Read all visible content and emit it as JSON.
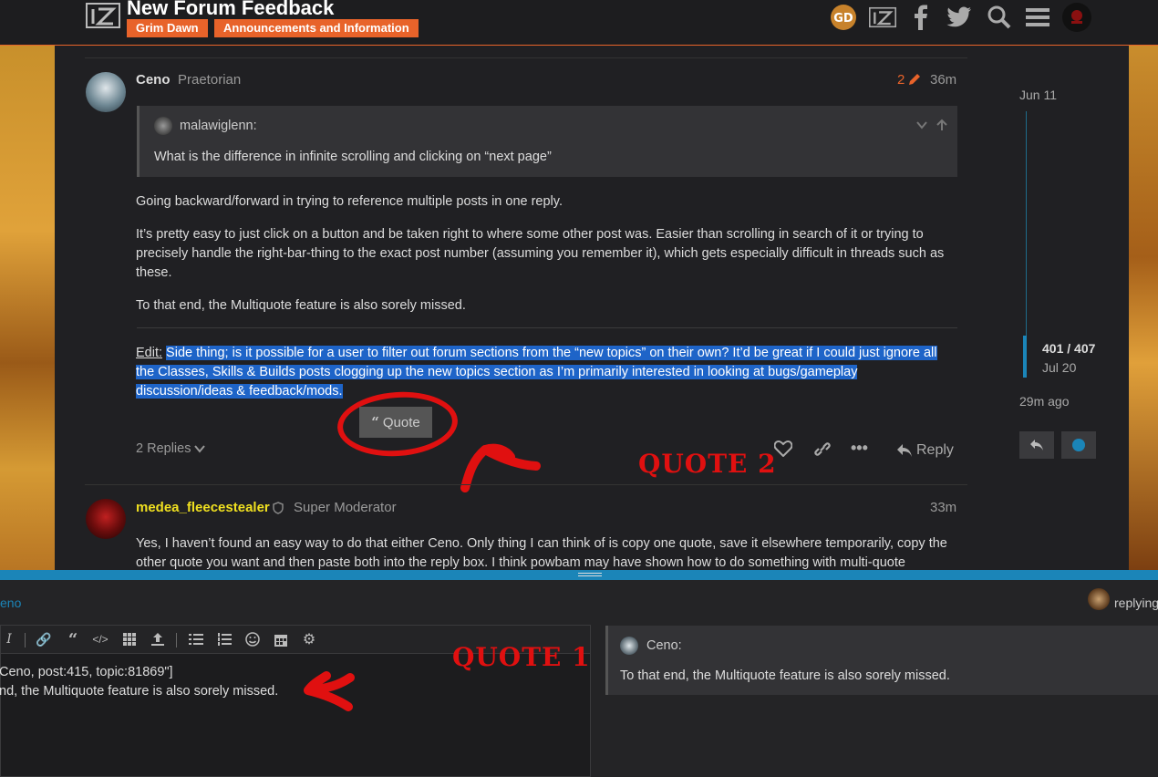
{
  "header": {
    "topic_title": "New Forum Feedback",
    "tags": [
      "Grim Dawn",
      "Announcements and Information"
    ],
    "icons": [
      "gd-logo-icon",
      "site-logo-icon",
      "facebook-icon",
      "twitter-icon",
      "search-icon",
      "hamburger-menu-icon",
      "user-avatar"
    ]
  },
  "post1": {
    "username": "Ceno",
    "user_title": "Praetorian",
    "edit_count": "2",
    "time": "36m",
    "quote": {
      "author": "malawiglenn:",
      "text": "What is the difference in infinite scrolling and clicking on “next page”"
    },
    "paragraphs": [
      "Going backward/forward in trying to reference multiple posts in one reply.",
      "It’s pretty easy to just click on a button and be taken right to where some other post was. Easier than scrolling in search of it or trying to precisely handle the right-bar-thing to the exact post number (assuming you remember it), which gets especially difficult in threads such as these.",
      "To that end, the Multiquote feature is also sorely missed."
    ],
    "edit_label": "Edit:",
    "edit_text": "Side thing; is it possible for a user to filter out forum sections from the “new topics” on their own? It’d be great if I could just ignore all the Classes, Skills & Builds posts clogging up the new topics section as I’m primarily interested in looking at bugs/gameplay discussion/ideas & feedback/mods.",
    "quote_button": "Quote",
    "replies": "2 Replies",
    "reply_button": "Reply"
  },
  "post2": {
    "username": "medea_fleecestealer",
    "user_title": "Super Moderator",
    "time": "33m",
    "text": "Yes, I haven’t found an easy way to do that either Ceno. Only thing I can think of is copy one quote, save it elsewhere temporarily, copy the other quote you want and then paste both into the reply box. I think powbam may have shown how to do something with multi-quote"
  },
  "annotations": {
    "quote2": "QUOTE 2",
    "quote1": "QUOTE 1"
  },
  "timeline": {
    "start_date": "Jun 11",
    "position": "401 / 407",
    "current_date": "Jul 20",
    "last_activity": "29m ago"
  },
  "composer": {
    "user_fragment": "eno",
    "replying_label": "replying",
    "editor_line1": "Ceno, post:415, topic:81869\"]",
    "editor_line2": "nd, the Multiquote feature is also sorely missed.",
    "preview_author": "Ceno:",
    "preview_text": "To that end, the Multiquote feature is also sorely missed."
  },
  "colors": {
    "accent_orange": "#e8632a",
    "accent_blue": "#1b85b8",
    "annotation_red": "#e01010",
    "moderator_yellow": "#f0e020"
  }
}
